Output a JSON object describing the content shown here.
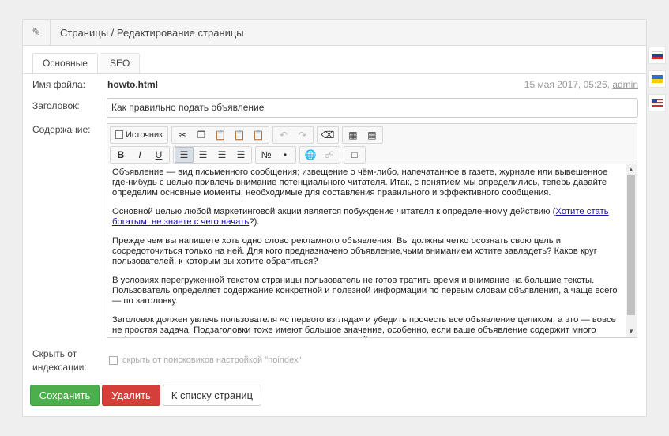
{
  "header": {
    "icon": "edit-icon",
    "title": "Страницы / Редактирование страницы"
  },
  "tabs": [
    {
      "label": "Основные",
      "active": true
    },
    {
      "label": "SEO",
      "active": false
    }
  ],
  "form": {
    "filename_label": "Имя файла:",
    "filename": "howto.html",
    "meta_date": "15 мая 2017, 05:26,",
    "meta_author": "admin",
    "title_label": "Заголовок:",
    "title_value": "Как правильно подать объявление",
    "content_label": "Содержание:",
    "hide_label_line1": "Скрыть от",
    "hide_label_line2": "индексации:",
    "noindex_label": "скрыть от поисковиков настройкой \"noindex\""
  },
  "toolbar": {
    "source_label": "Источник",
    "bold": "B",
    "italic": "I",
    "underline": "U"
  },
  "content": {
    "p1": "Объявление — вид письменного сообщения; извещение о чём-либо, напечатанное в газете, журнале или вывешенное где-нибудь с целью привлечь внимание потенциального читателя. Итак, с понятием  мы определились, теперь давайте определим основные моменты, необходимые для составления правильного  и эффективного сообщения.",
    "p2_before": "Основной целью любой маркетинговой акции является побуждение читателя к определенному действию (",
    "p2_link": "Хотите стать богатым, не знаете с чего начать",
    "p2_after": "?).",
    "p3": "Прежде чем вы напишете хоть одно слово рекламного объявления, Вы должны четко осознать свою цель и сосредоточиться только на ней. Для кого предназначено объявление,чьим вниманием хотите завладеть? Каков круг пользователей, к которым вы хотите обратиться?",
    "p4": "В условиях перегруженной текстом страницы пользователь не готов тратить время и внимание на большие тексты. Пользователь определяет содержание конкретной и полезной информации по первым словам объявления, а чаще всего — по заголовку.",
    "p5": "Заголовок должен увлечь пользователя «с первого взгляда» и убедить прочесть все объявление целиком, а это — вовсе не простая задача. Подзаголовки тоже имеют большое значение, особенно, если ваше объявление содержит много информации, по, непомещается даже если и заголовок такой."
  },
  "buttons": {
    "save": "Сохранить",
    "delete": "Удалить",
    "back": "К списку страниц"
  },
  "languages": [
    "ru",
    "ua",
    "en"
  ],
  "colors": {
    "save": "#4cae4c",
    "delete": "#d43f3a",
    "link": "#1a0dab"
  }
}
